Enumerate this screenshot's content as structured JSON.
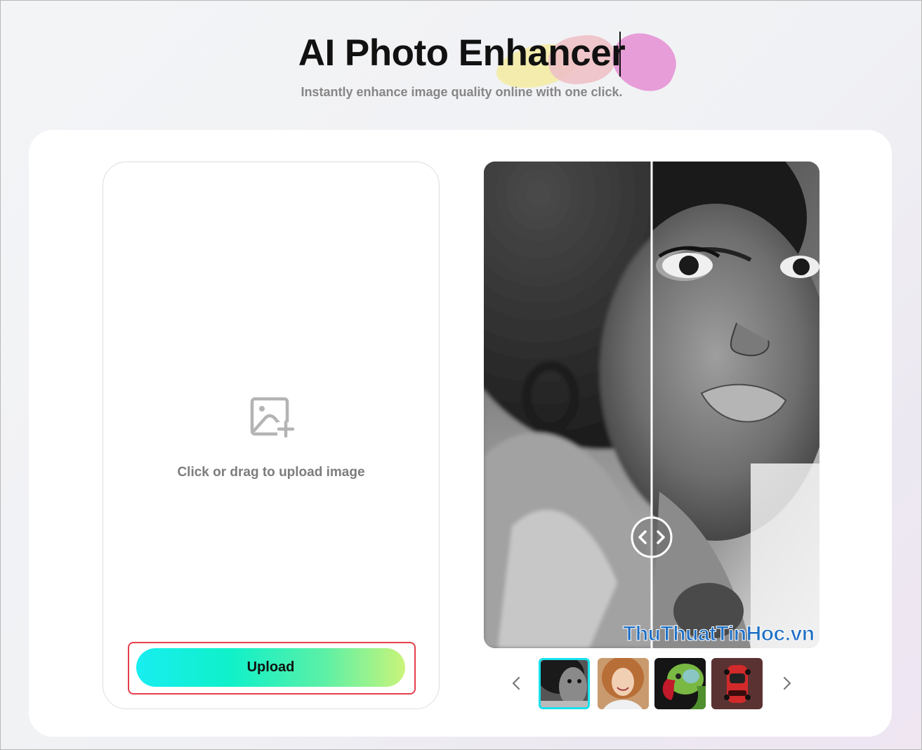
{
  "header": {
    "title": "AI Photo Enhancer",
    "subtitle": "Instantly enhance image quality online with one click."
  },
  "upload": {
    "hint": "Click or drag to upload image",
    "button_label": "Upload",
    "icon": "image-add-icon"
  },
  "preview": {
    "slider_icon": "left-right-arrows-icon",
    "watermark": "ThuThuatTinHoc.vn"
  },
  "gallery": {
    "prev_icon": "chevron-left-icon",
    "next_icon": "chevron-right-icon",
    "thumbnails": [
      "portrait-woman-bw",
      "portrait-woman-smiling",
      "parrot",
      "red-car"
    ],
    "active_index": 0
  },
  "colors": {
    "accent_start": "#18eef0",
    "accent_end": "#c9f47a",
    "highlight_border": "#e53e4b",
    "active_thumb_border": "#17e1ee"
  }
}
